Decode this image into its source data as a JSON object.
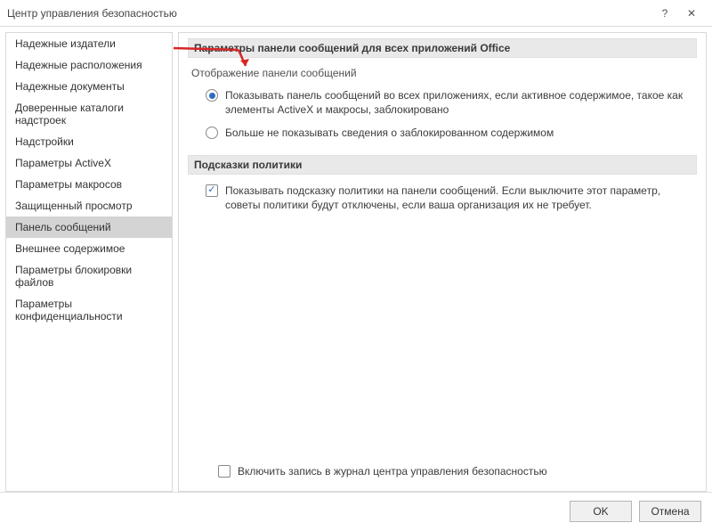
{
  "window": {
    "title": "Центр управления безопасностью"
  },
  "sidebar": {
    "items": [
      {
        "label": "Надежные издатели"
      },
      {
        "label": "Надежные расположения"
      },
      {
        "label": "Надежные документы"
      },
      {
        "label": "Доверенные каталоги надстроек"
      },
      {
        "label": "Надстройки"
      },
      {
        "label": "Параметры ActiveX"
      },
      {
        "label": "Параметры макросов"
      },
      {
        "label": "Защищенный просмотр"
      },
      {
        "label": "Панель сообщений"
      },
      {
        "label": "Внешнее содержимое"
      },
      {
        "label": "Параметры блокировки файлов"
      },
      {
        "label": "Параметры конфиденциальности"
      }
    ],
    "selected_index": 8
  },
  "content": {
    "section1_title": "Параметры панели сообщений для всех приложений Office",
    "subheading": "Отображение панели сообщений",
    "radio1": "Показывать панель сообщений во всех приложениях, если активное содержимое, такое как элементы ActiveX и макросы, заблокировано",
    "radio2": "Больше не показывать сведения о заблокированном содержимом",
    "section2_title": "Подсказки политики",
    "check1": "Показывать подсказку политики на панели сообщений. Если выключите этот параметр, советы политики будут отключены, если ваша организация их не требует.",
    "check2": "Включить запись в журнал центра управления безопасностью"
  },
  "buttons": {
    "ok": "OK",
    "cancel": "Отмена"
  }
}
